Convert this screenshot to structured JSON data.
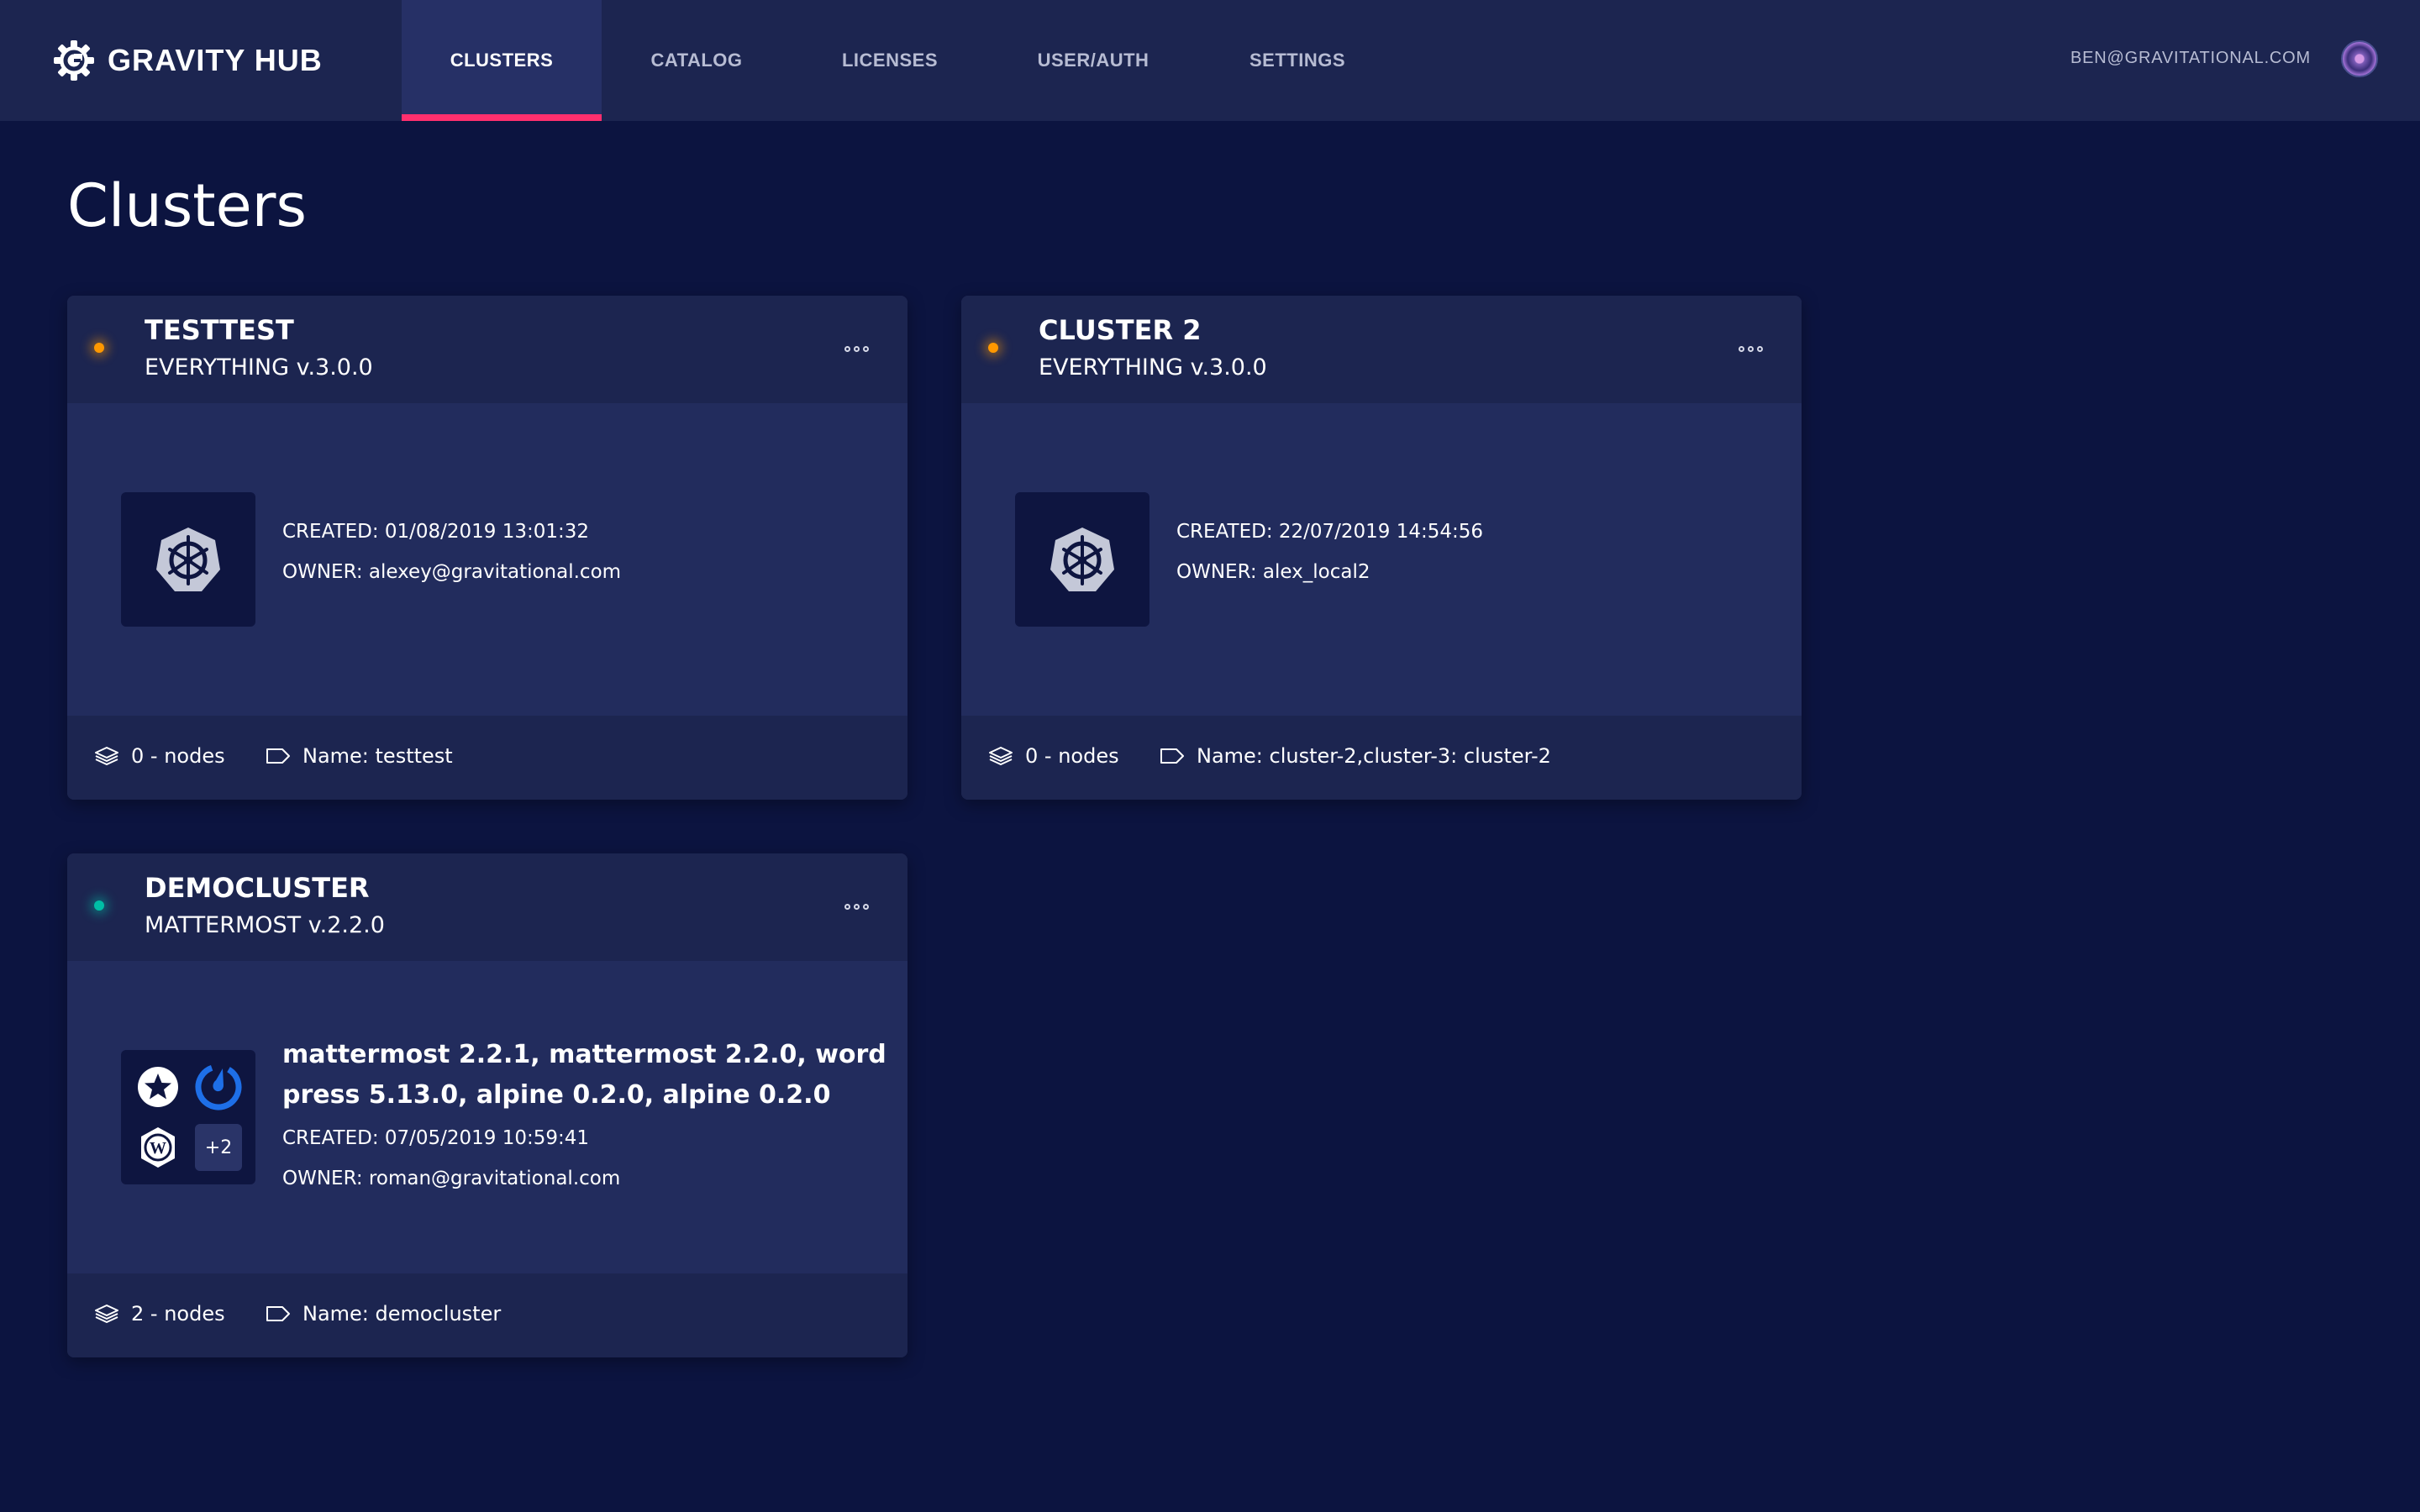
{
  "brand": {
    "name": "GRAVITY HUB",
    "logo_icon": "gear-g-logo-icon"
  },
  "nav": {
    "tabs": [
      {
        "label": "CLUSTERS",
        "active": true
      },
      {
        "label": "CATALOG",
        "active": false
      },
      {
        "label": "LICENSES",
        "active": false
      },
      {
        "label": "USER/AUTH",
        "active": false
      },
      {
        "label": "SETTINGS",
        "active": false
      }
    ]
  },
  "user": {
    "email": "BEN@GRAVITATIONAL.COM",
    "avatar_icon": "avatar-icon"
  },
  "page": {
    "title": "Clusters"
  },
  "colors": {
    "background": "#0c1440",
    "topbar": "#1c2550",
    "card": "#222c5d",
    "accent": "#ff2f6e",
    "status_orange": "#ff9800",
    "status_green": "#00bfa5"
  },
  "clusters": [
    {
      "name": "TESTTEST",
      "version": "EVERYTHING v.3.0.0",
      "status": "orange",
      "icon": "kubernetes-icon",
      "apps": "",
      "created": "CREATED: 01/08/2019 13:01:32",
      "owner": "OWNER: alexey@gravitational.com",
      "nodes": "0 - nodes",
      "labels": "Name: testtest"
    },
    {
      "name": "CLUSTER 2",
      "version": "EVERYTHING v.3.0.0",
      "status": "orange",
      "icon": "kubernetes-icon",
      "apps": "",
      "created": "CREATED: 22/07/2019 14:54:56",
      "owner": "OWNER: alex_local2",
      "nodes": "0 - nodes",
      "labels": "Name: cluster-2,cluster-3: cluster-2"
    },
    {
      "name": "DEMOCLUSTER",
      "version": "MATTERMOST v.2.2.0",
      "status": "green",
      "icon": "app-icons-grid",
      "apps": "mattermost 2.2.1, mattermost 2.2.0, wordpress 5.13.0, alpine 0.2.0, alpine 0.2.0",
      "more_apps": "+2",
      "created": "CREATED: 07/05/2019 10:59:41",
      "owner": "OWNER: roman@gravitational.com",
      "nodes": "2 - nodes",
      "labels": "Name: democluster"
    }
  ]
}
